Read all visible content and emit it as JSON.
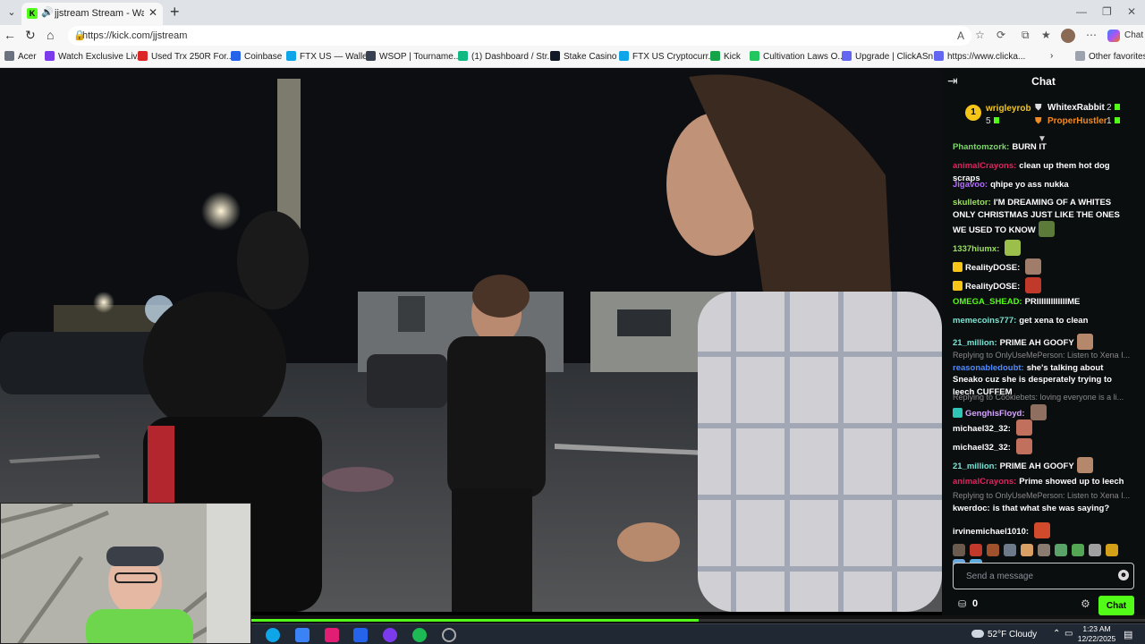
{
  "browser": {
    "tab_title": "jjstream Stream - Watch Live",
    "tab_close": "✕",
    "new_tab": "+",
    "url": "https://kick.com/jjstream",
    "copilot_label": "Chat",
    "bookmarks": [
      {
        "label": "Acer",
        "color": "#6b7280"
      },
      {
        "label": "Watch Exclusive Liv...",
        "color": "#7c3aed"
      },
      {
        "label": "Used Trx 250R For...",
        "color": "#dc2626"
      },
      {
        "label": "Coinbase",
        "color": "#2563eb"
      },
      {
        "label": "FTX US — Wallet",
        "color": "#0ea5e9"
      },
      {
        "label": "WSOP | Tourname...",
        "color": "#374151"
      },
      {
        "label": "(1) Dashboard / Str...",
        "color": "#10b981"
      },
      {
        "label": "Stake Casino",
        "color": "#111827"
      },
      {
        "label": "FTX US Cryptocurr...",
        "color": "#0ea5e9"
      },
      {
        "label": "Kick",
        "color": "#16a34a"
      },
      {
        "label": "Cultivation Laws O...",
        "color": "#22c55e"
      },
      {
        "label": "Upgrade | ClickASn...",
        "color": "#6366f1"
      },
      {
        "label": "https://www.clicka...",
        "color": "#6366f1"
      }
    ],
    "other_favorites": "Other favorites"
  },
  "chat": {
    "title": "Chat",
    "gifters": {
      "top": {
        "rank": "1",
        "name": "wrigleyrob",
        "count": "5"
      },
      "second": {
        "name": "WhitexRabbit",
        "count": "2"
      },
      "third": {
        "name": "ProperHustler",
        "count": "1"
      }
    },
    "messages": [
      {
        "user": "Phantomzork:",
        "color": "#7cd66b",
        "text": "BURN IT"
      },
      {
        "user": "animalCrayons:",
        "color": "#e0245e",
        "text": "clean up them hot dog scraps"
      },
      {
        "user": "Jigavoo:",
        "color": "#b36bff",
        "text": "qhipe yo ass nukka"
      },
      {
        "user": "skulletor:",
        "color": "#9be15d",
        "text": "I'M DREAMING OF A WHITES ONLY CHRISTMAS JUST LIKE THE ONES WE USED TO KNOW"
      },
      {
        "user": "1337hiumx:",
        "color": "#9be15d",
        "text": ""
      },
      {
        "user": "RealityDOSE:",
        "color": "#ffffff",
        "text": ""
      },
      {
        "user": "RealityDOSE:",
        "color": "#ffffff",
        "text": ""
      },
      {
        "user": "OMEGA_SHEAD:",
        "color": "#53fc18",
        "text": "PRIIIIIIIIIIIIIME"
      },
      {
        "user": "memecoins777:",
        "color": "#7ee3d4",
        "text": "get xena to clean"
      },
      {
        "user": "21_million:",
        "color": "#7ee3d4",
        "text": "PRIME AH GOOFY"
      },
      {
        "user": "reasonabledoubt:",
        "color": "#4f8bff",
        "reply": "Replying to OnlyUseMePerson: Listen to Xena I...",
        "text": "she's talking about Sneako cuz she is desperately trying to leech CUFFEM"
      },
      {
        "user": "GenghisFloyd:",
        "color": "#d6a5ff",
        "reply": "Replying to Cookiebets: loving everyone is a li...",
        "text": ""
      },
      {
        "user": "michael32_32:",
        "color": "#ffffff",
        "text": ""
      },
      {
        "user": "michael32_32:",
        "color": "#ffffff",
        "text": ""
      },
      {
        "user": "21_million:",
        "color": "#7ee3d4",
        "text": "PRIME AH GOOFY"
      },
      {
        "user": "animalCrayons:",
        "color": "#e0245e",
        "text": "Prime showed up to leech"
      },
      {
        "user": "kwerdoc:",
        "color": "#ffffff",
        "reply": "Replying to OnlyUseMePerson: Listen to Xena I...",
        "text": "is that what she was saying?"
      },
      {
        "user": "irvinemichael1010:",
        "color": "#ffffff",
        "text": ""
      }
    ],
    "input_placeholder": "Send a message",
    "points": "0",
    "send_label": "Chat"
  },
  "player": {
    "progress_fraction": 0.5
  },
  "taskbar": {
    "weather": "52°F  Cloudy",
    "time": "1:23 AM",
    "date": "12/22/2025"
  },
  "colors": {
    "kick_green": "#53fc18",
    "chat_bg": "#0b0e0f"
  }
}
